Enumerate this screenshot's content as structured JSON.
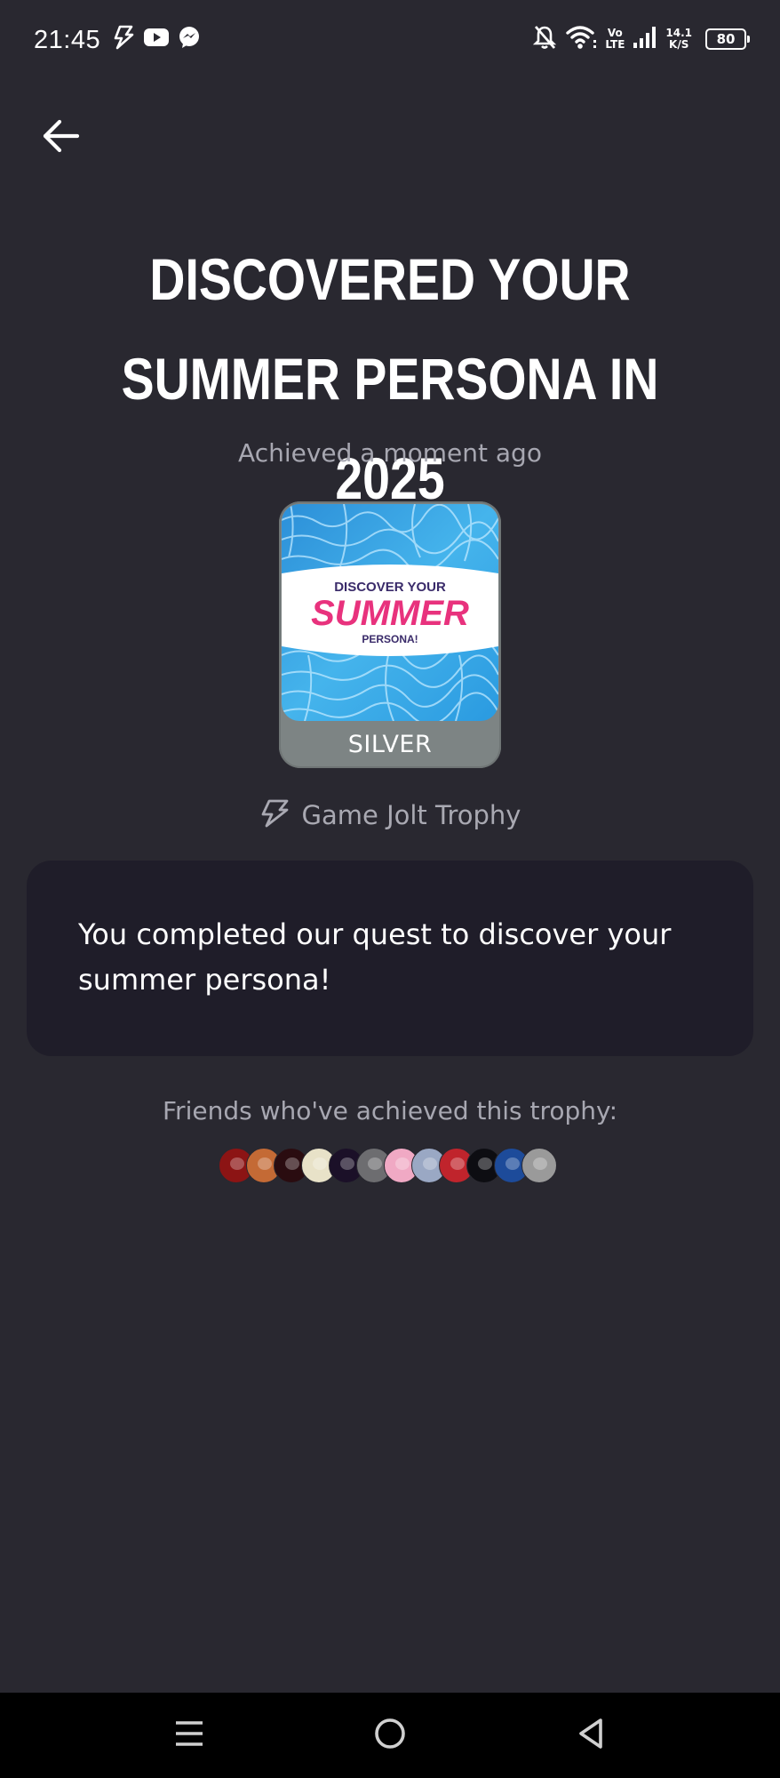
{
  "status_bar": {
    "time": "21:45",
    "left_icons": [
      "flash-icon",
      "youtube-icon",
      "messenger-icon"
    ],
    "right_icons": [
      "notifications-off-icon",
      "wifi-icon",
      "volte-icon",
      "cell-signal-icon"
    ],
    "volte_top": "Vo",
    "volte_bottom": "LTE",
    "speed_value": "14.1",
    "speed_unit": "K/S",
    "battery_level": "80"
  },
  "header": {
    "back_icon": "arrow-left-icon"
  },
  "trophy": {
    "title": "DISCOVERED YOUR SUMMER PERSONA IN 2025",
    "achieved": "Achieved a moment ago",
    "image_text_top": "DISCOVER YOUR",
    "image_text_main": "SUMMER",
    "image_text_bottom": "PERSONA!",
    "tier": "SILVER",
    "type_icon": "game-jolt-icon",
    "type_label": "Game Jolt Trophy",
    "description": "You completed our quest to discover your summer persona!"
  },
  "friends": {
    "label": "Friends who've achieved this trophy:",
    "avatars": [
      {
        "name": "friend-avatar-1",
        "color": "#8c1414"
      },
      {
        "name": "friend-avatar-2",
        "color": "#c46a35"
      },
      {
        "name": "friend-avatar-3",
        "color": "#2a0c10"
      },
      {
        "name": "friend-avatar-4",
        "color": "#e8e2c8"
      },
      {
        "name": "friend-avatar-5",
        "color": "#1b1028"
      },
      {
        "name": "friend-avatar-6",
        "color": "#6d6d70"
      },
      {
        "name": "friend-avatar-7",
        "color": "#f0a9c4"
      },
      {
        "name": "friend-avatar-8",
        "color": "#9aa8c4"
      },
      {
        "name": "friend-avatar-9",
        "color": "#c0242c"
      },
      {
        "name": "friend-avatar-10",
        "color": "#0d0d12"
      },
      {
        "name": "friend-avatar-11",
        "color": "#1d4b9a"
      },
      {
        "name": "friend-avatar-12",
        "color": "#9a9a9a"
      }
    ]
  },
  "nav_bar": {
    "items": [
      "menu-icon",
      "home-icon",
      "back-triangle-icon"
    ]
  },
  "colors": {
    "background": "#292830",
    "card": "#1f1d29",
    "muted_text": "#a7a7b1",
    "silver_tier": "#7d8484"
  }
}
